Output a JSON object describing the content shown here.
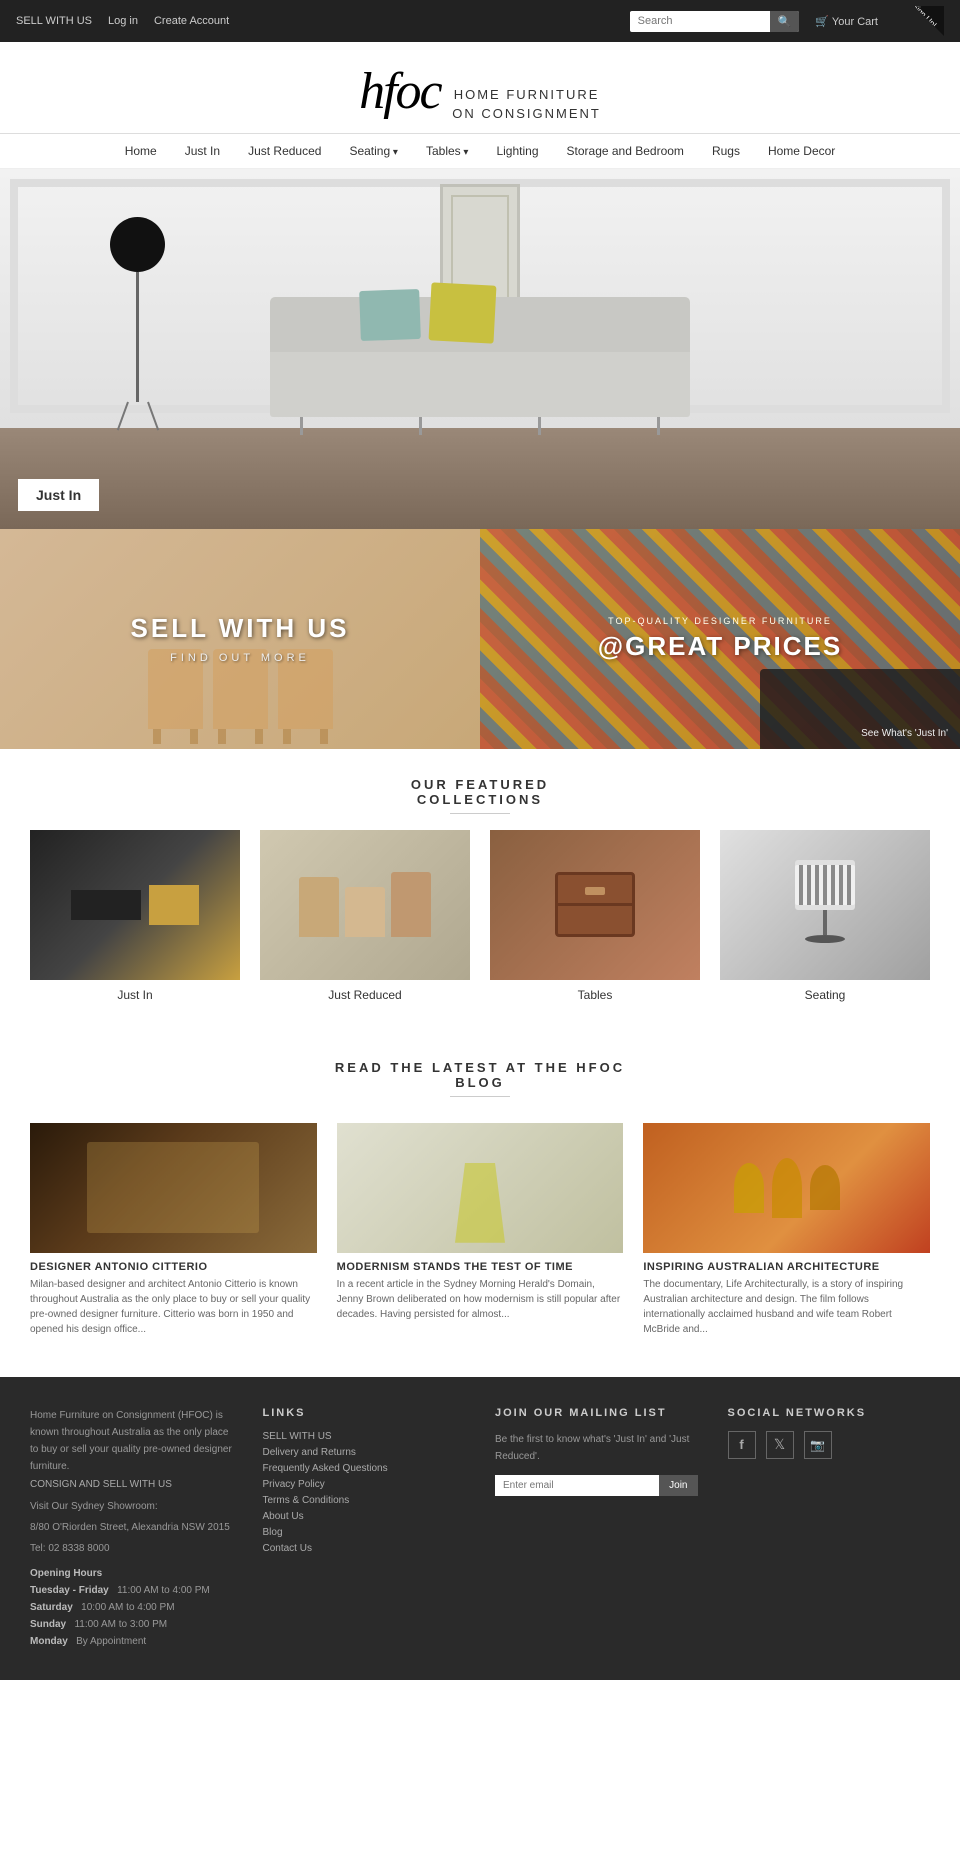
{
  "topbar": {
    "sell_with_us": "SELL WITH US",
    "login": "Log in",
    "create_account": "Create Account",
    "search_placeholder": "Search",
    "search_button": "🔍",
    "cart": "🛒 Your Cart",
    "signup": "Sign Up!"
  },
  "logo": {
    "brand": "hfoc",
    "line1": "HOME FURNITURE",
    "line2": "ON CONSIGNMENT"
  },
  "nav": {
    "items": [
      {
        "label": "Home",
        "dropdown": false
      },
      {
        "label": "Just In",
        "dropdown": false
      },
      {
        "label": "Just Reduced",
        "dropdown": false
      },
      {
        "label": "Seating",
        "dropdown": true
      },
      {
        "label": "Tables",
        "dropdown": true
      },
      {
        "label": "Lighting",
        "dropdown": false
      },
      {
        "label": "Storage and Bedroom",
        "dropdown": false
      },
      {
        "label": "Rugs",
        "dropdown": false
      },
      {
        "label": "Home Decor",
        "dropdown": false
      }
    ]
  },
  "hero": {
    "label": "Just In"
  },
  "banners": {
    "left": {
      "heading": "SELL WITH US",
      "subtext": "FIND OUT MORE"
    },
    "right": {
      "small": "TOP-QUALITY DESIGNER FURNITURE",
      "heading": "@GREAT PRICES",
      "link": "See What's 'Just In'"
    }
  },
  "featured": {
    "title": "OUR FEATURED",
    "subtitle": "COLLECTIONS",
    "items": [
      {
        "label": "Just In"
      },
      {
        "label": "Just Reduced"
      },
      {
        "label": "Tables"
      },
      {
        "label": "Seating"
      }
    ]
  },
  "blog": {
    "title_line1": "READ THE LATEST AT THE HFOC",
    "title_line2": "BLOG",
    "posts": [
      {
        "title": "DESIGNER ANTONIO CITTERIO",
        "text": "Milan-based designer and architect Antonio Citterio is known throughout Australia as the only place to buy or sell your quality pre-owned designer furniture. Citterio was born in 1950 and opened his design office..."
      },
      {
        "title": "MODERNISM STANDS THE TEST OF TIME",
        "text": "In a recent article in the Sydney Morning Herald's Domain, Jenny Brown deliberated on how modernism is still popular after decades. Having persisted for almost..."
      },
      {
        "title": "INSPIRING AUSTRALIAN ARCHITECTURE",
        "text": "The documentary, Life Architecturally, is a story of inspiring Australian architecture and design. The film follows internationally acclaimed husband and wife team Robert McBride and..."
      }
    ]
  },
  "footer": {
    "about": {
      "text": "Home Furniture on Consignment (HFOC) is known throughout Australia as the only place to buy or sell your quality pre-owned designer furniture.",
      "consign_link": "CONSIGN AND SELL WITH US",
      "visit": "Visit Our Sydney Showroom:",
      "address": "8/80 O'Riorden Street, Alexandria NSW 2015",
      "tel": "Tel: 02 8338 8000",
      "hours_title": "Opening Hours",
      "hours": [
        {
          "day": "Tuesday - Friday",
          "time": "11:00 AM to 4:00 PM"
        },
        {
          "day": "Saturday",
          "time": "10:00 AM to 4:00 PM"
        },
        {
          "day": "Sunday",
          "time": "11:00 AM to 3:00 PM"
        },
        {
          "day": "Monday",
          "time": "By Appointment"
        }
      ]
    },
    "links": {
      "title": "LINKS",
      "items": [
        "SELL WITH US",
        "Delivery and Returns",
        "Frequently Asked Questions",
        "Privacy Policy",
        "Terms & Conditions",
        "About Us",
        "Blog",
        "Contact Us"
      ]
    },
    "mailing": {
      "title": "JOIN OUR MAILING LIST",
      "description": "Be the first to know what's 'Just In' and 'Just Reduced'.",
      "placeholder": "Enter email",
      "button": "Join"
    },
    "social": {
      "title": "SOCIAL NETWORKS",
      "networks": [
        "f",
        "🐦",
        "📷"
      ]
    }
  }
}
